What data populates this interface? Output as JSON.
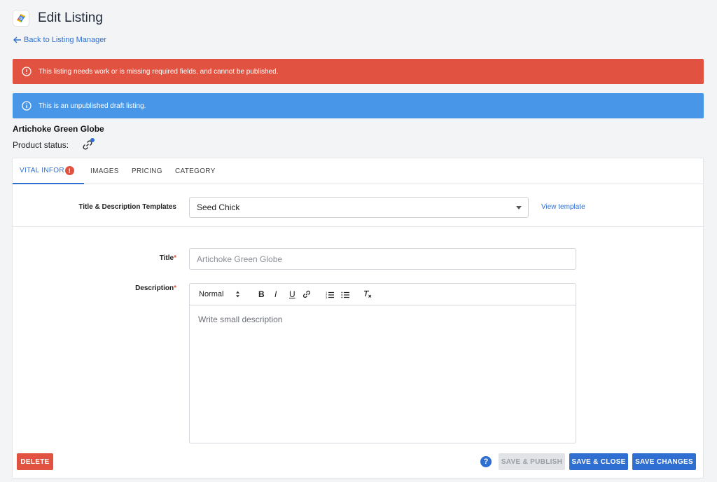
{
  "header": {
    "title": "Edit Listing",
    "back_label": "Back to Listing Manager"
  },
  "alerts": {
    "error": "This listing needs work or is missing required fields, and cannot be published.",
    "info": "This is an unpublished draft listing."
  },
  "product": {
    "name": "Artichoke Green Globe",
    "status_label": "Product status:"
  },
  "tabs": [
    {
      "label": "VITAL INFOR",
      "badge": "!"
    },
    {
      "label": "IMAGES"
    },
    {
      "label": "PRICING"
    },
    {
      "label": "CATEGORY"
    }
  ],
  "templates": {
    "label": "Title & Description Templates",
    "value": "Seed Chick",
    "view_link": "View template"
  },
  "title_field": {
    "label": "Title",
    "required_mark": "*",
    "placeholder": "Artichoke Green Globe"
  },
  "description_field": {
    "label": "Description",
    "required_mark": "*",
    "format_value": "Normal",
    "toolbar": {
      "bold": "B",
      "italic": "I",
      "underline": "U"
    },
    "placeholder": "Write small description"
  },
  "buttons": {
    "delete": "DELETE",
    "help": "?",
    "save_publish": "SAVE & PUBLISH",
    "save_close": "SAVE & CLOSE",
    "save_changes": "SAVE CHANGES"
  },
  "colors": {
    "accent": "#2f6fd1",
    "error": "#e15241",
    "info": "#4796e8"
  }
}
